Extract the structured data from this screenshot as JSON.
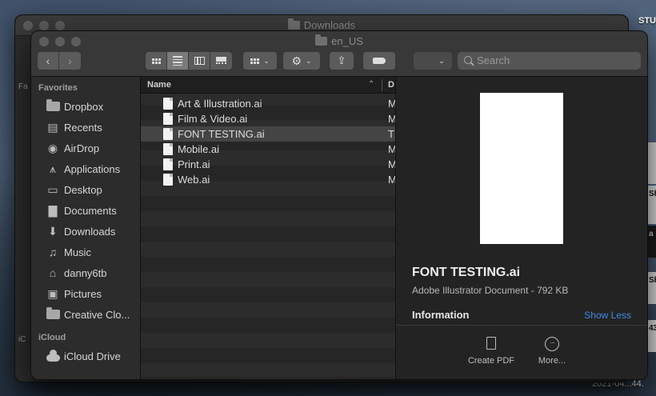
{
  "desktop": {
    "label_top_right": "STU",
    "timestamp_bottom_right": "2021-04...44.",
    "thumb_labels": [
      "Sh",
      "a",
      "Sh",
      "43",
      "Sh"
    ]
  },
  "back_window": {
    "title": "Downloads",
    "side_labels": [
      "Fa",
      "iC"
    ]
  },
  "window": {
    "title": "en_US",
    "search_placeholder": "Search"
  },
  "sidebar": {
    "favorites_header": "Favorites",
    "favorites": [
      {
        "label": "Dropbox",
        "icon": "folder-icon"
      },
      {
        "label": "Recents",
        "icon": "recents-icon"
      },
      {
        "label": "AirDrop",
        "icon": "airdrop-icon"
      },
      {
        "label": "Applications",
        "icon": "applications-icon"
      },
      {
        "label": "Desktop",
        "icon": "desktop-icon"
      },
      {
        "label": "Documents",
        "icon": "documents-icon"
      },
      {
        "label": "Downloads",
        "icon": "downloads-icon"
      },
      {
        "label": "Music",
        "icon": "music-icon"
      },
      {
        "label": "danny6tb",
        "icon": "home-icon"
      },
      {
        "label": "Pictures",
        "icon": "pictures-icon"
      },
      {
        "label": "Creative Clo...",
        "icon": "folder-icon"
      }
    ],
    "icloud_header": "iCloud",
    "icloud": [
      {
        "label": "iCloud Drive",
        "icon": "cloud-icon"
      }
    ]
  },
  "file_list": {
    "header_name": "Name",
    "header_date": "D",
    "files": [
      {
        "name": "Art & Illustration.ai",
        "kind": "M"
      },
      {
        "name": "Film & Video.ai",
        "kind": "M"
      },
      {
        "name": "FONT TESTING.ai",
        "kind": "T",
        "selected": true
      },
      {
        "name": "Mobile.ai",
        "kind": "M"
      },
      {
        "name": "Print.ai",
        "kind": "M"
      },
      {
        "name": "Web.ai",
        "kind": "M"
      }
    ]
  },
  "preview": {
    "file_name": "FONT TESTING.ai",
    "meta": "Adobe Illustrator Document - 792 KB",
    "information_label": "Information",
    "show_less_label": "Show Less",
    "actions": [
      {
        "label": "Create PDF",
        "icon": "pdf-icon"
      },
      {
        "label": "More...",
        "icon": "more-icon"
      }
    ],
    "link_color": "#3f8be8"
  }
}
